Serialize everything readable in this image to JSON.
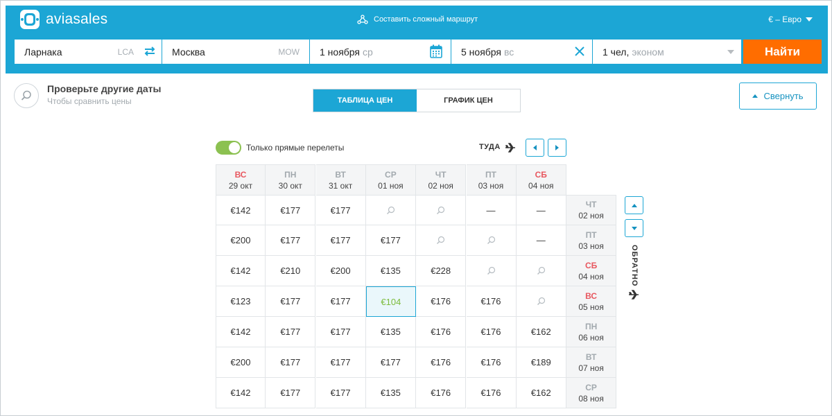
{
  "header": {
    "logo_text": "aviasales",
    "complex_route": "Составить сложный маршрут",
    "currency": "€ – Евро"
  },
  "search": {
    "origin": "Ларнака",
    "origin_code": "LCA",
    "destination": "Москва",
    "destination_code": "MOW",
    "depart_date": "1 ноября",
    "depart_dow": "ср",
    "return_date": "5 ноября",
    "return_dow": "вс",
    "passengers": "1 чел,",
    "cabin": "эконом",
    "find_label": "Найти"
  },
  "alt_dates": {
    "title": "Проверьте другие даты",
    "subtitle": "Чтобы сравнить цены",
    "tab_table": "ТАБЛИЦА ЦЕН",
    "tab_graph": "ГРАФИК ЦЕН",
    "collapse_label": "Свернуть"
  },
  "filters": {
    "direct_only": "Только прямые перелеты",
    "direct_only_on": true,
    "there_label": "ТУДА",
    "back_label": "ОБРАТНО"
  },
  "price_table": {
    "columns": [
      {
        "dow": "ВС",
        "date": "29 окт",
        "weekend": true
      },
      {
        "dow": "ПН",
        "date": "30 окт",
        "weekend": false
      },
      {
        "dow": "ВТ",
        "date": "31 окт",
        "weekend": false
      },
      {
        "dow": "СР",
        "date": "01 ноя",
        "weekend": false
      },
      {
        "dow": "ЧТ",
        "date": "02 ноя",
        "weekend": false
      },
      {
        "dow": "ПТ",
        "date": "03 ноя",
        "weekend": false
      },
      {
        "dow": "СБ",
        "date": "04 ноя",
        "weekend": true
      }
    ],
    "rows": [
      {
        "dow": "ЧТ",
        "date": "02 ноя",
        "weekend": false,
        "cells": [
          "€142",
          "€177",
          "€177",
          "search",
          "search",
          "—",
          "—"
        ]
      },
      {
        "dow": "ПТ",
        "date": "03 ноя",
        "weekend": false,
        "cells": [
          "€200",
          "€177",
          "€177",
          "€177",
          "search",
          "search",
          "—"
        ]
      },
      {
        "dow": "СБ",
        "date": "04 ноя",
        "weekend": true,
        "cells": [
          "€142",
          "€210",
          "€200",
          "€135",
          "€228",
          "search",
          "search"
        ]
      },
      {
        "dow": "ВС",
        "date": "05 ноя",
        "weekend": true,
        "cells": [
          "€123",
          "€177",
          "€177",
          "€104",
          "€176",
          "€176",
          "search"
        ]
      },
      {
        "dow": "ПН",
        "date": "06 ноя",
        "weekend": false,
        "cells": [
          "€142",
          "€177",
          "€177",
          "€135",
          "€176",
          "€176",
          "€162"
        ]
      },
      {
        "dow": "ВТ",
        "date": "07 ноя",
        "weekend": false,
        "cells": [
          "€200",
          "€177",
          "€177",
          "€177",
          "€176",
          "€176",
          "€189"
        ]
      },
      {
        "dow": "СР",
        "date": "08 ноя",
        "weekend": false,
        "cells": [
          "€142",
          "€177",
          "€177",
          "€135",
          "€176",
          "€176",
          "€162"
        ]
      }
    ],
    "best_price": "€104"
  },
  "colors": {
    "brand": "#1ca6d5",
    "cta": "#ff6d00",
    "best_price": "#7cbb3c",
    "weekend": "#e8575f"
  }
}
